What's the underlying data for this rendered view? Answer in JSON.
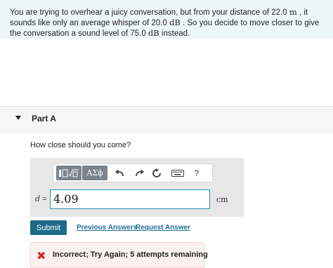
{
  "problem": {
    "part1": "You are trying to overhear a juicy conversation, but from your distance of 22.0 ",
    "unit1": "m",
    "part2": " , it sounds like only an average whisper of 20.0 ",
    "unit2": "dB",
    "part3": " . So you decide to move closer to give the conversation a sound level of 75.0 ",
    "unit3": "dB",
    "part4": " instead."
  },
  "part": {
    "title": "Part A"
  },
  "question": "How close should you come?",
  "toolbar": {
    "greek_label": "ΑΣϕ",
    "help_label": "?",
    "icons": [
      "templates-icon",
      "greek-letters",
      "undo-icon",
      "redo-icon",
      "reset-icon",
      "keyboard-icon",
      "help-icon"
    ]
  },
  "answer": {
    "variable": "d",
    "equals": "=",
    "value": "4.09",
    "unit": "cm"
  },
  "actions": {
    "submit_label": "Submit",
    "previous_answers": "Previous Answers",
    "request_answer": "Request Answer"
  },
  "feedback": {
    "text": "Incorrect; Try Again; 5 attempts remaining",
    "color": "#d12a2a"
  },
  "colors": {
    "accent": "#1d6b87",
    "link": "#1e6f98",
    "problem_bg": "#eef7f8"
  }
}
